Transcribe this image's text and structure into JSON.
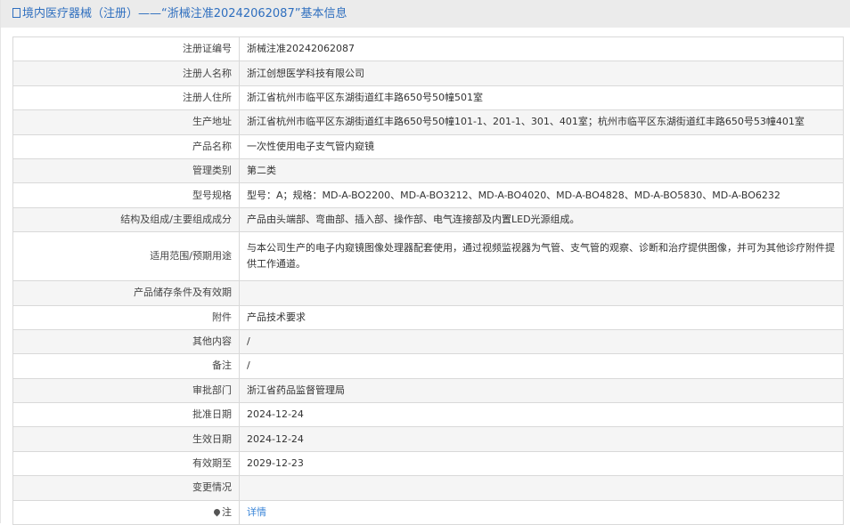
{
  "header": {
    "title": "境内医疗器械（注册）——“浙械注准20242062087”基本信息",
    "icon": "document-icon"
  },
  "rows": [
    {
      "label": "注册证编号",
      "value": "浙械注准20242062087"
    },
    {
      "label": "注册人名称",
      "value": "浙江创想医学科技有限公司"
    },
    {
      "label": "注册人住所",
      "value": "浙江省杭州市临平区东湖街道红丰路650号50幢501室"
    },
    {
      "label": "生产地址",
      "value": "浙江省杭州市临平区东湖街道红丰路650号50幢101-1、201-1、301、401室；杭州市临平区东湖街道红丰路650号53幢401室"
    },
    {
      "label": "产品名称",
      "value": "一次性使用电子支气管内窥镜"
    },
    {
      "label": "管理类别",
      "value": "第二类"
    },
    {
      "label": "型号规格",
      "value": "型号：A；规格：MD-A-BO2200、MD-A-BO3212、MD-A-BO4020、MD-A-BO4828、MD-A-BO5830、MD-A-BO6232"
    },
    {
      "label": "结构及组成/主要组成成分",
      "value": "产品由头端部、弯曲部、插入部、操作部、电气连接部及内置LED光源组成。"
    },
    {
      "label": "适用范围/预期用途",
      "value": "与本公司生产的电子内窥镜图像处理器配套使用，通过视频监视器为气管、支气管的观察、诊断和治疗提供图像，并可为其他诊疗附件提供工作通道。"
    },
    {
      "label": "产品储存条件及有效期",
      "value": ""
    },
    {
      "label": "附件",
      "value": "产品技术要求"
    },
    {
      "label": "其他内容",
      "value": "/"
    },
    {
      "label": "备注",
      "value": "/"
    },
    {
      "label": "审批部门",
      "value": "浙江省药品监督管理局"
    },
    {
      "label": "批准日期",
      "value": "2024-12-24"
    },
    {
      "label": "生效日期",
      "value": "2024-12-24"
    },
    {
      "label": "有效期至",
      "value": "2029-12-23"
    },
    {
      "label": "变更情况",
      "value": ""
    }
  ],
  "note": {
    "label": "注",
    "link": "详情"
  }
}
